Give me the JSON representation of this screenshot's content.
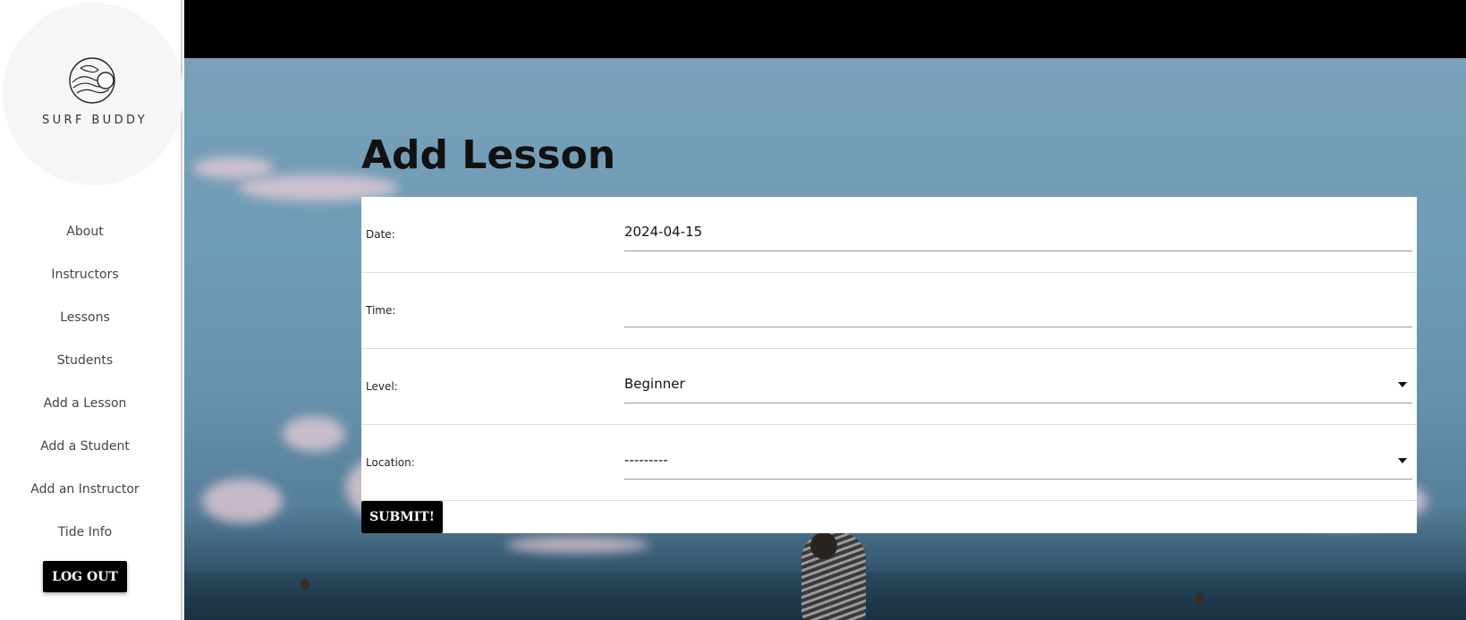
{
  "brand": {
    "name": "SURF BUDDY",
    "logo_icon": "wave-circle-logo-icon"
  },
  "sidebar": {
    "items": [
      {
        "label": "About"
      },
      {
        "label": "Instructors"
      },
      {
        "label": "Lessons"
      },
      {
        "label": "Students"
      },
      {
        "label": "Add a Lesson"
      },
      {
        "label": "Add a Student"
      },
      {
        "label": "Add an Instructor"
      },
      {
        "label": "Tide Info"
      }
    ],
    "logout_label": "LOG OUT"
  },
  "main": {
    "title": "Add Lesson",
    "form": {
      "date": {
        "label": "Date:",
        "value": "2024-04-15"
      },
      "time": {
        "label": "Time:",
        "value": ""
      },
      "level": {
        "label": "Level:",
        "value": "Beginner"
      },
      "location": {
        "label": "Location:",
        "value": "---------"
      },
      "submit_label": "SUBMIT!"
    }
  },
  "colors": {
    "topbar": "#000000",
    "button_bg": "#000000",
    "button_text": "#ffffff",
    "sidebar_bg": "#ffffff"
  }
}
